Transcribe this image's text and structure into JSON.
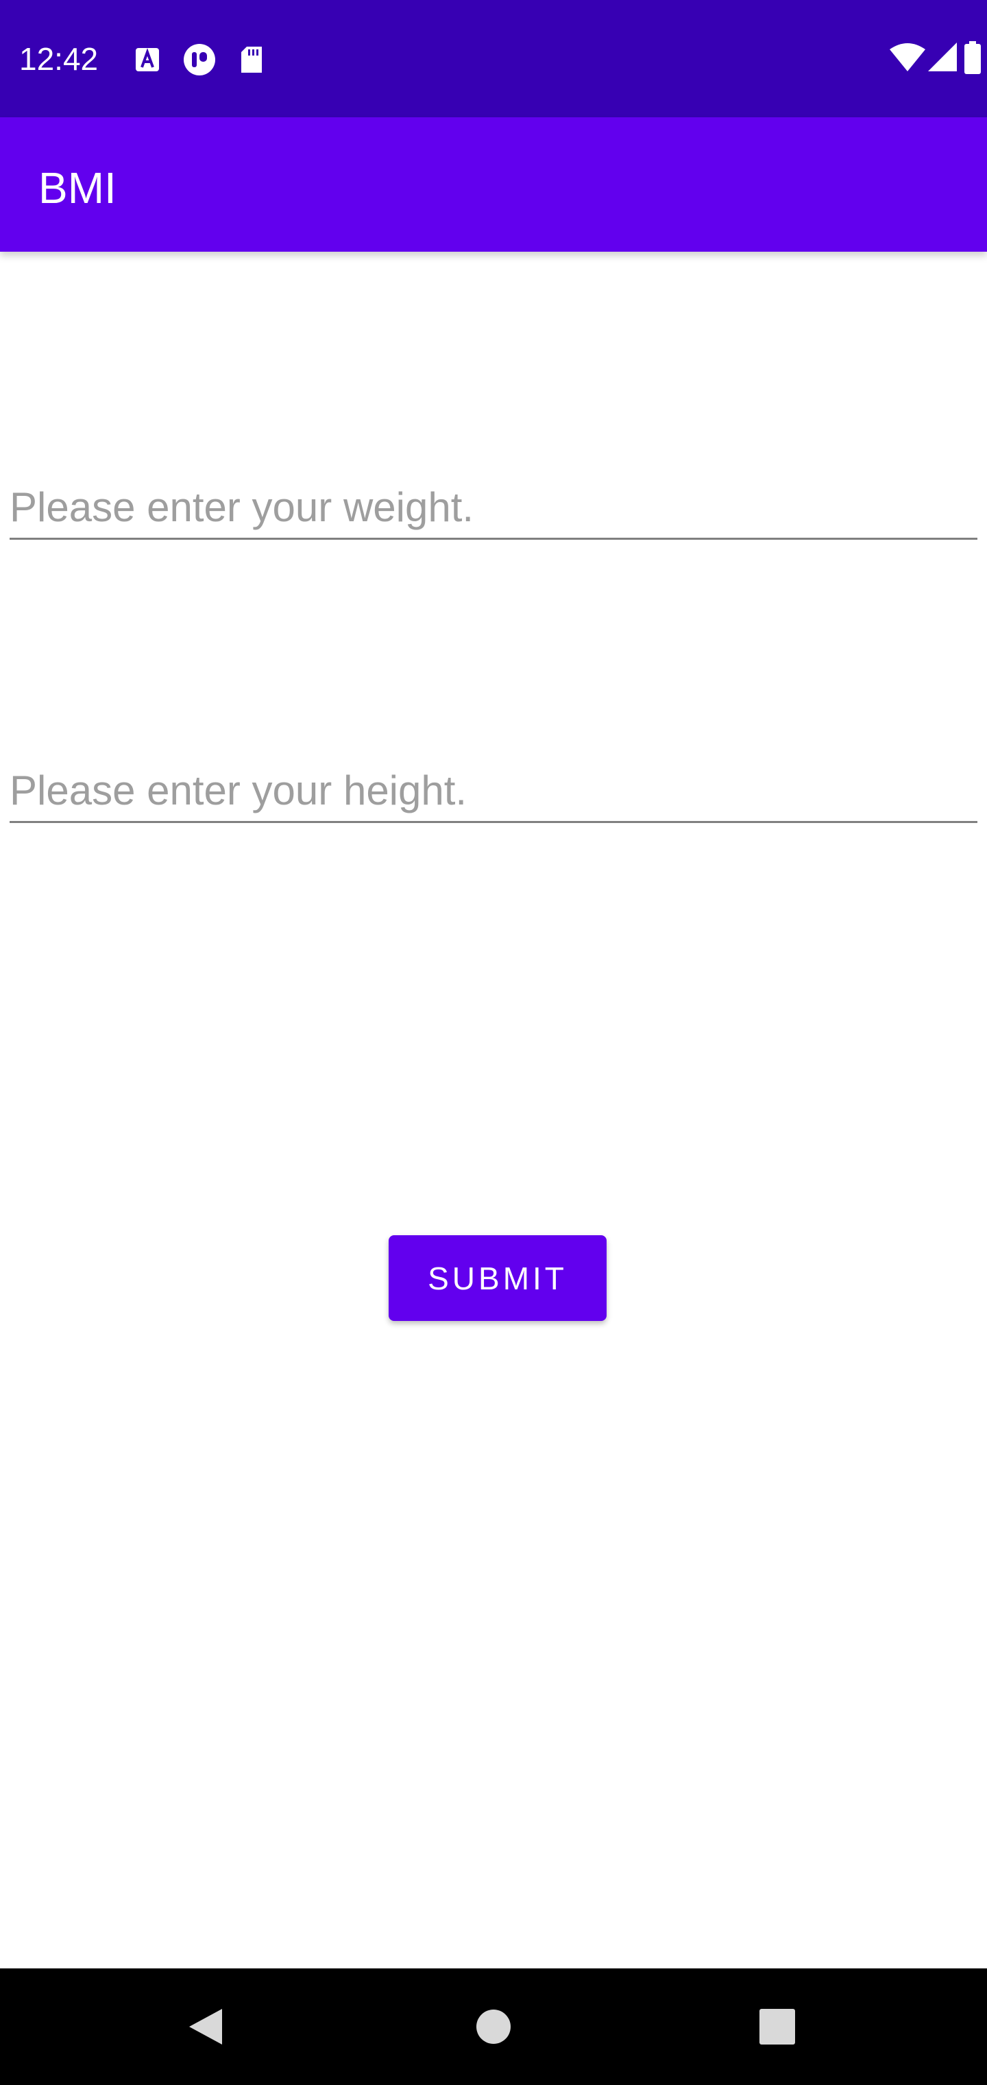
{
  "status_bar": {
    "time": "12:42",
    "icons": [
      "keyboard-a-icon",
      "notification-app-icon",
      "sd-card-icon",
      "wifi-icon",
      "cellular-signal-icon",
      "battery-icon"
    ]
  },
  "app_bar": {
    "title": "BMI"
  },
  "form": {
    "weight": {
      "value": "",
      "placeholder": "Please enter your weight."
    },
    "height": {
      "value": "",
      "placeholder": "Please enter your height."
    },
    "submit_label": "SUBMIT"
  },
  "navigation": {
    "icons": [
      "back-icon",
      "home-icon",
      "recents-icon"
    ]
  },
  "colors": {
    "status_bar": "#3700b3",
    "primary": "#6200ee",
    "hint_text": "#9e9e9e",
    "underline": "#808080"
  }
}
